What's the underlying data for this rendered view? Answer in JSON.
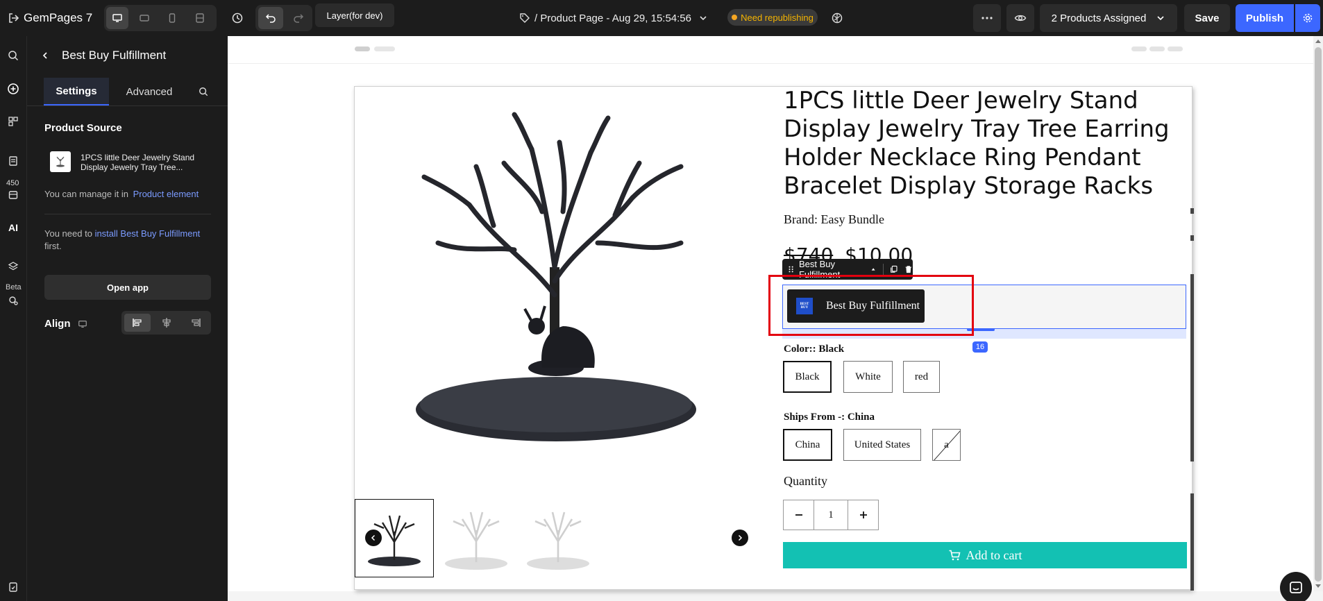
{
  "app": {
    "name": "GemPages",
    "version": "7",
    "layer_button": "Layer(for dev)",
    "page_title": "/ Product Page - Aug 29, 15:54:56",
    "republish_badge": "Need republishing",
    "products_assigned": "2 Products Assigned",
    "save_label": "Save",
    "publish_label": "Publish"
  },
  "rail": {
    "count_badge": "450",
    "ai_label": "AI",
    "beta_label": "Beta"
  },
  "panel": {
    "title": "Best Buy Fulfillment",
    "tabs": [
      "Settings",
      "Advanced"
    ],
    "product_source_label": "Product Source",
    "product_name": "1PCS little Deer Jewelry Stand Display Jewelry Tray Tree...",
    "manage_text": "You can manage it in",
    "manage_link": "Product element",
    "install_prefix": "You need to",
    "install_link": "install Best Buy Fulfillment",
    "install_suffix": "first.",
    "open_app": "Open app",
    "align_label": "Align"
  },
  "product": {
    "title": "1PCS little Deer Jewelry Stand Display Jewelry Tray Tree Earring Holder Necklace Ring Pendant Bracelet Display Storage Racks",
    "brand": "Brand: Easy Bundle",
    "price_old": "$740",
    "price_new": "$10.00",
    "element_toolbar_label": "Best Buy Fulfillment",
    "bbf_button": "Best Buy Fulfillment",
    "bbf_logo": "BEST BUY",
    "spacing_badge": "16",
    "color_label": "Color:: Black",
    "colors": [
      "Black",
      "White",
      "red"
    ],
    "ships_label": "Ships From -: China",
    "ships": [
      "China",
      "United States",
      "a"
    ],
    "quantity_label": "Quantity",
    "quantity_value": "1",
    "add_to_cart": "Add to cart"
  },
  "colors": {
    "accent": "#3c67ff",
    "cart": "#13c1b3",
    "badge": "#f5a623",
    "highlight": "#e3000f"
  }
}
